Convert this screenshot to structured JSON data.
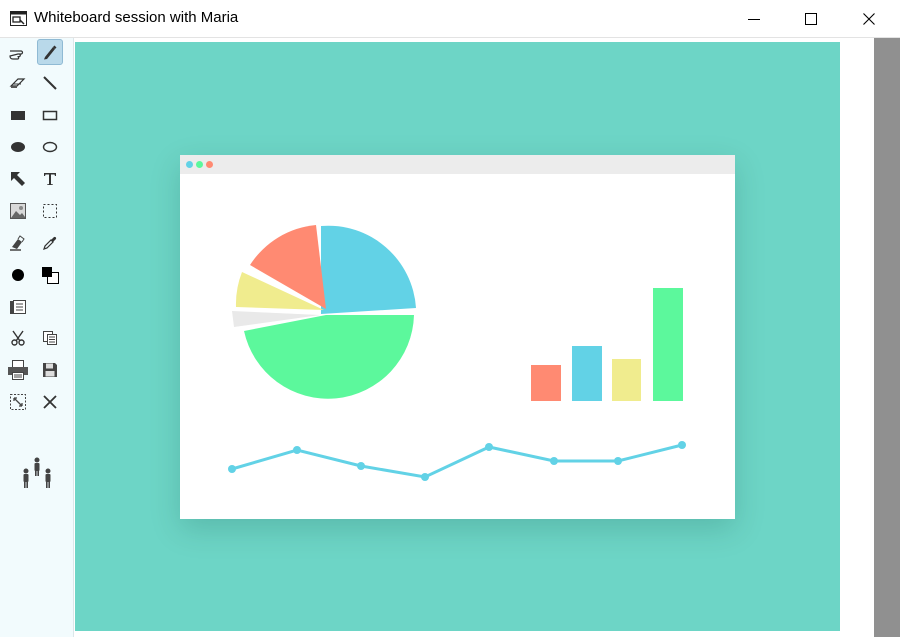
{
  "window": {
    "title": "Whiteboard session with Maria",
    "app_icon": "whiteboard-app-icon",
    "controls": [
      "minimize-icon",
      "maximize-icon",
      "close-icon"
    ]
  },
  "toolbar": {
    "active_tool": "pen",
    "tools": [
      "pointer-hand-icon",
      "pen-icon",
      "eraser-icon",
      "line-icon",
      "filled-rectangle-icon",
      "rectangle-outline-icon",
      "filled-ellipse-icon",
      "ellipse-outline-icon",
      "arrow-icon",
      "text-icon",
      "image-icon",
      "select-region-icon",
      "highlighter-icon",
      "eyedropper-icon",
      "brush-size-icon",
      "color-swatch-icon",
      "pages-icon",
      "cut-icon",
      "copy-icon",
      "print-icon",
      "save-icon",
      "fit-screen-icon",
      "clear-icon",
      "participants-icon"
    ],
    "current_colors": {
      "foreground": "#000000",
      "background": "#ffffff"
    }
  },
  "colors": {
    "board_background": "#6dd5c6",
    "chart_blue": "#62d2e6",
    "chart_green": "#5cf89c",
    "chart_salmon": "#ff8a72",
    "chart_yellow": "#f0ec8e",
    "chart_light_gray": "#e9e9e9",
    "scrollbar_gray": "#909090"
  },
  "drawing": {
    "description_icons": [
      "pie-chart-graphic",
      "bar-chart-graphic",
      "line-chart-graphic"
    ],
    "pie_slices": [
      {
        "color": "#62d2e6",
        "value": 25
      },
      {
        "color": "#5cf89c",
        "value": 48
      },
      {
        "color": "#e9e9e9",
        "value": 2
      },
      {
        "color": "#f0ec8e",
        "value": 8
      },
      {
        "color": "#ff8a72",
        "value": 14
      }
    ],
    "bars": [
      {
        "color": "#ff8a72",
        "value": 28
      },
      {
        "color": "#62d2e6",
        "value": 42
      },
      {
        "color": "#f0ec8e",
        "value": 32
      },
      {
        "color": "#5cf89c",
        "value": 86
      }
    ],
    "line_values": [
      42,
      62,
      45,
      38,
      60,
      51,
      52,
      62
    ]
  }
}
